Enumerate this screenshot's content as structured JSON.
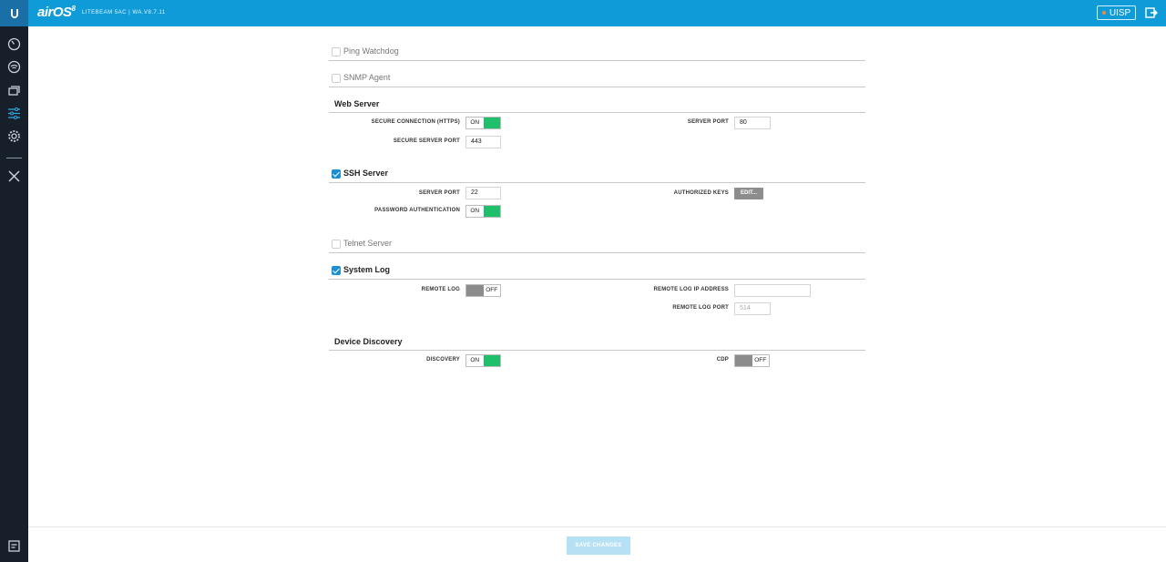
{
  "header": {
    "brand": "airOS",
    "brand_version": "8",
    "device_info": "LITEBEAM 5AC | WA.V8.7.11",
    "uisp_label": "UISP",
    "colors": {
      "topbar": "#0e9bd8",
      "sidebar": "#17202a",
      "toggle_on": "#1fbf6b",
      "toggle_off": "#8c8c8c",
      "check": "#1e8fd3"
    }
  },
  "sidebar": {
    "icons": [
      "dashboard-icon",
      "wireless-icon",
      "network-icon",
      "services-icon",
      "settings-icon",
      "tools-icon",
      "console-icon"
    ]
  },
  "ping_watchdog": {
    "label": "Ping Watchdog",
    "checked": false
  },
  "snmp_agent": {
    "label": "SNMP Agent",
    "checked": false
  },
  "web_server": {
    "title": "Web Server",
    "secure_connection_label": "SECURE CONNECTION (HTTPS)",
    "secure_connection_state": "ON",
    "secure_port_label": "SECURE SERVER PORT",
    "secure_port_value": "443",
    "server_port_label": "SERVER PORT",
    "server_port_value": "80"
  },
  "ssh_server": {
    "label": "SSH Server",
    "checked": true,
    "server_port_label": "SERVER PORT",
    "server_port_value": "22",
    "password_auth_label": "PASSWORD AUTHENTICATION",
    "password_auth_state": "ON",
    "authorized_keys_label": "AUTHORIZED KEYS",
    "edit_label": "EDIT..."
  },
  "telnet_server": {
    "label": "Telnet Server",
    "checked": false
  },
  "system_log": {
    "label": "System Log",
    "checked": true,
    "remote_log_label": "REMOTE LOG",
    "remote_log_state": "OFF",
    "remote_ip_label": "REMOTE LOG IP ADDRESS",
    "remote_ip_value": "",
    "remote_port_label": "REMOTE LOG PORT",
    "remote_port_value": "514"
  },
  "device_discovery": {
    "title": "Device Discovery",
    "discovery_label": "DISCOVERY",
    "discovery_state": "ON",
    "cdp_label": "CDP",
    "cdp_state": "OFF"
  },
  "footer": {
    "save_label": "SAVE CHANGES"
  }
}
